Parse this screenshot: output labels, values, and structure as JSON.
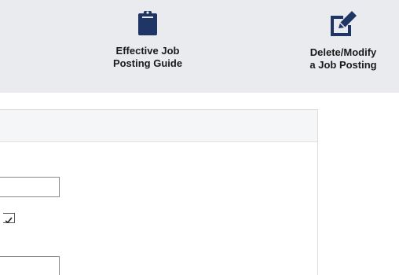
{
  "toolbar": {
    "items": [
      {
        "label_line1": "Effective Job",
        "label_line2": "Posting Guide",
        "icon": "clipboard-icon"
      },
      {
        "label_line1": "Delete/Modify",
        "label_line2": "a Job Posting",
        "icon": "edit-icon"
      }
    ]
  },
  "colors": {
    "toolbar_bg": "#e9ebee",
    "icon_navy": "#1f3566",
    "panel_header_bg": "#f5f6f7"
  }
}
